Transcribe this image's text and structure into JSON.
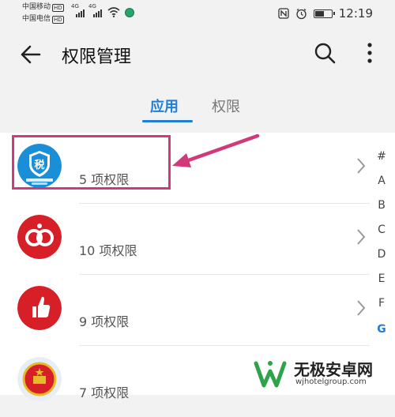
{
  "status_bar": {
    "carrier1": "中国移动",
    "carrier2": "中国电信",
    "hd_label": "HD",
    "net1": "4G",
    "net2": "4G",
    "time": "12:19",
    "battery_level": 0.6,
    "icons": [
      "nfc-icon",
      "alarm-icon",
      "battery-icon",
      "wifi-icon",
      "signal-icon"
    ]
  },
  "app_bar": {
    "title": "权限管理",
    "icons": [
      "back-arrow-icon",
      "search-icon",
      "more-vert-icon"
    ]
  },
  "tabs": [
    {
      "label": "应用",
      "selected": true
    },
    {
      "label": "权限",
      "selected": false
    }
  ],
  "apps": [
    {
      "name": "",
      "permissions": "5 项权限",
      "icon": "tax-shield-icon",
      "icon_color": "#1a8fd8"
    },
    {
      "name": "",
      "permissions": "10 项权限",
      "icon": "red-rings-icon",
      "icon_color": "#d61f26"
    },
    {
      "name": "",
      "permissions": "9 项权限",
      "icon": "thumbs-up-icon",
      "icon_color": "#d61f26"
    },
    {
      "name": "",
      "permissions": "7 项权限",
      "icon": "national-emblem-icon",
      "icon_color": "#2f7fd4"
    }
  ],
  "index_letters": [
    "#",
    "A",
    "B",
    "C",
    "D",
    "E",
    "F",
    "G"
  ],
  "index_active": "G",
  "icon_text": {
    "tax_char": "税"
  },
  "watermark": {
    "name": "无极安卓网",
    "url": "wjhotelgroup.com"
  },
  "colors": {
    "accent": "#1e7ed8",
    "highlight": "#d1397a"
  }
}
